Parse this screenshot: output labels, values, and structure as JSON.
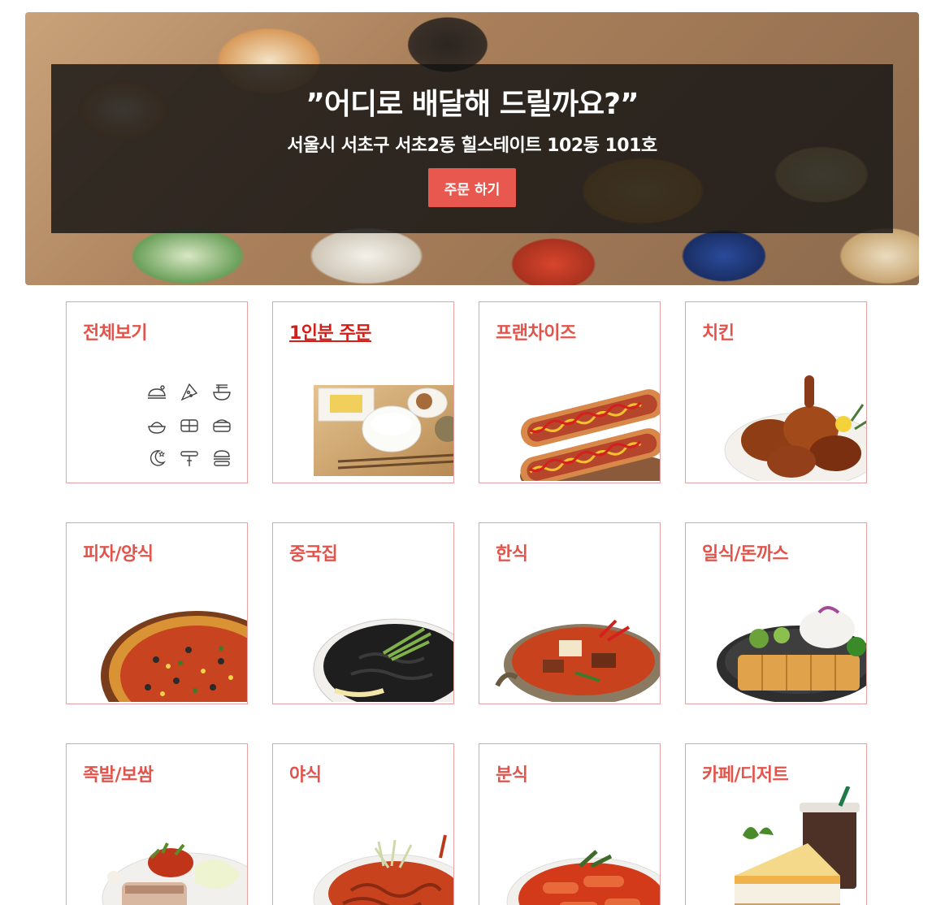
{
  "hero": {
    "title": "”어디로 배달해 드릴까요?”",
    "address": "서울시 서초구 서초2동 힐스테이트 102동 101호",
    "order_button": "주문 하기"
  },
  "colors": {
    "accent": "#e8584f",
    "label": "#e2544b",
    "active_label": "#d1201a",
    "card_border": "#e8a0a0"
  },
  "categories": [
    {
      "label": "전체보기",
      "image": "category-icons"
    },
    {
      "label": "1인분 주문",
      "image": "korean-set-meal",
      "active": true
    },
    {
      "label": "프랜차이즈",
      "image": "hotdog"
    },
    {
      "label": "치킨",
      "image": "fried-chicken"
    },
    {
      "label": "피자/양식",
      "image": "pizza"
    },
    {
      "label": "중국집",
      "image": "jjajangmyeon"
    },
    {
      "label": "한식",
      "image": "stew"
    },
    {
      "label": "일식/돈까스",
      "image": "tonkatsu"
    },
    {
      "label": "족발/보쌈",
      "image": "bossam"
    },
    {
      "label": "야식",
      "image": "spicy-noodles"
    },
    {
      "label": "분식",
      "image": "tteokbokki"
    },
    {
      "label": "카페/디저트",
      "image": "cake-and-coffee"
    }
  ],
  "all_icons": [
    "chicken-icon",
    "pizza-icon",
    "noodle-bowl-icon",
    "rice-bowl-icon",
    "lunchbox-icon",
    "sushi-icon",
    "night-moon-icon",
    "snack-icon",
    "burger-icon"
  ]
}
